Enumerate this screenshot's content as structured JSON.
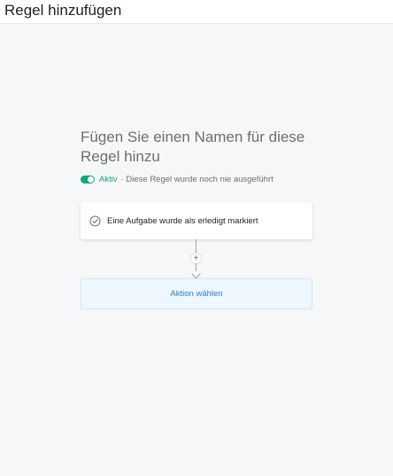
{
  "window": {
    "title": "Regel hinzufügen"
  },
  "rule": {
    "name_placeholder": "Fügen Sie einen Namen für diese Regel hinzu",
    "status_active": "Aktiv",
    "status_description": "· Diese Regel wurde noch nie ausgeführt",
    "toggle_on": true
  },
  "trigger": {
    "icon": "check-circle-icon",
    "label": "Eine Aufgabe wurde als erledigt markiert"
  },
  "connector": {
    "add_symbol": "+",
    "add_icon": "plus-icon",
    "arrow_icon": "arrow-down-icon"
  },
  "action": {
    "label": "Aktion wählen"
  },
  "colors": {
    "accent_green": "#14a47e",
    "action_blue": "#2a83c6",
    "action_bg": "#edf7fd",
    "page_bg": "#f6f7f8"
  }
}
